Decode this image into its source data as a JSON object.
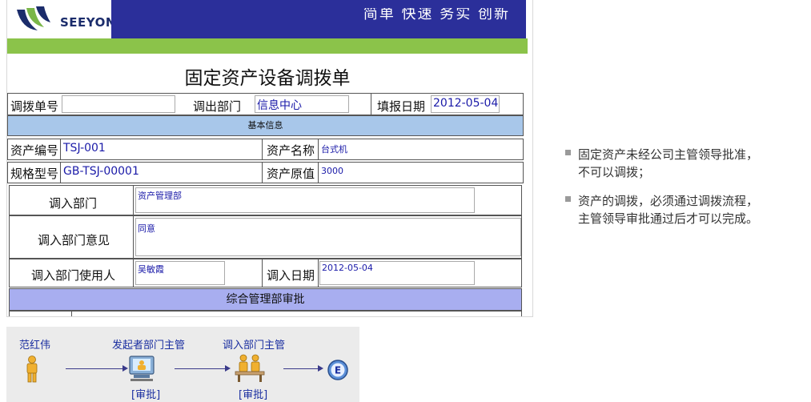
{
  "banner": {
    "logo_text": "SEEYON",
    "slogan": "简单 快速 务实 创新",
    "blue": "#2b2f9a",
    "green": "#8bc34a"
  },
  "form": {
    "title": "固定资产设备调拨单",
    "header": {
      "doc_no_label": "调拨单号",
      "doc_no_value": "",
      "out_dept_label": "调出部门",
      "out_dept_value": "信息中心",
      "date_label": "填报日期",
      "date_value": "2012-05-04"
    },
    "basic_info_label": "基本信息",
    "asset_no_label": "资产编号",
    "asset_no_value": "TSJ-001",
    "asset_name_label": "资产名称",
    "asset_name_value": "台式机",
    "spec_label": "规格型号",
    "spec_value": "GB-TSJ-00001",
    "orig_value_label": "资产原值",
    "orig_value_value": "3000",
    "in_dept_label": "调入部门",
    "in_dept_value": "资产管理部",
    "in_dept_opinion_label": "调入部门意见",
    "in_dept_opinion_value": "同意",
    "in_dept_user_label": "调入部门使用人",
    "in_dept_user_value": "吴敏霞",
    "in_date_label": "调入日期",
    "in_date_value": "2012-05-04",
    "approval_label": "综合管理部审批"
  },
  "flow": {
    "nodes": [
      {
        "name": "范红伟",
        "action": "",
        "icon": "person-icon"
      },
      {
        "name": "发起者部门主管",
        "action": "[审批]",
        "icon": "computer-user-icon"
      },
      {
        "name": "调入部门主管",
        "action": "[审批]",
        "icon": "group-desk-icon"
      },
      {
        "name": "",
        "action": "",
        "icon": "end-icon",
        "label": "E"
      }
    ]
  },
  "notes": [
    {
      "line1": "固定资产未经公司主管领导批准，",
      "line2": "不可以调拨；"
    },
    {
      "line1": "资产的调拨，必须通过调拨流程，",
      "line2": "主管领导审批通过后才可以完成。"
    }
  ]
}
